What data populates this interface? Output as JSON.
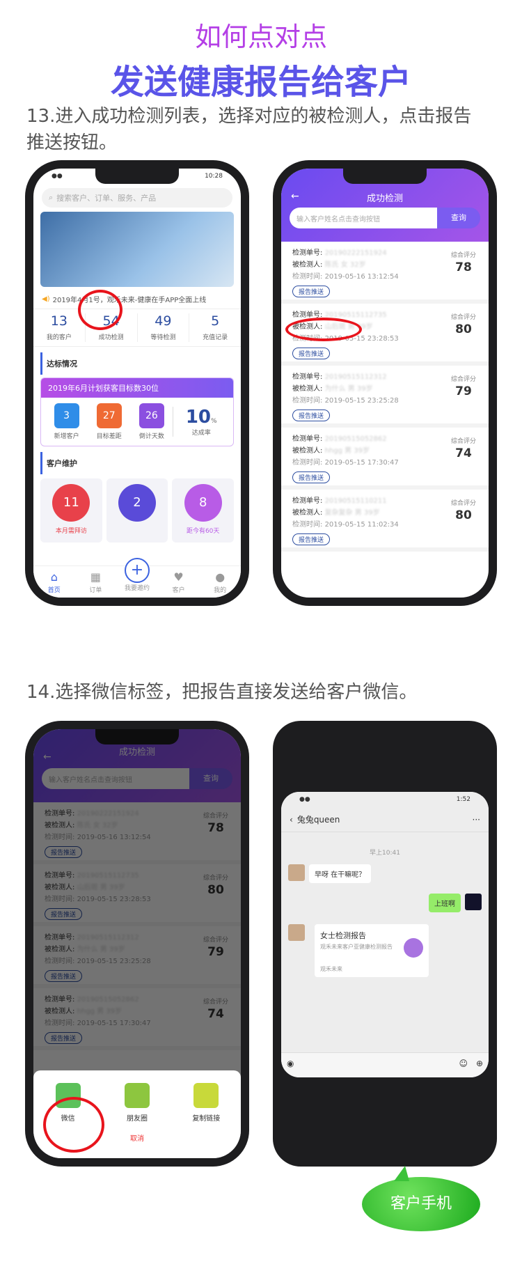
{
  "header": {
    "line1": "如何点对点",
    "line2": "发送健康报告给客户"
  },
  "step13": {
    "line1": "13.进入成功检测列表，选择对应的被检测人，点击报告",
    "line2": "推送按钮。"
  },
  "step14": "14.选择微信标签，把报告直接发送给客户微信。",
  "home": {
    "time": "10:28",
    "search_placeholder": "搜索客户、订单、服务、产品",
    "notice": "2019年4月1号，观禾未来-健康在手APP全面上线",
    "stats": [
      {
        "value": "13",
        "label": "我的客户"
      },
      {
        "value": "54",
        "label": "成功检测"
      },
      {
        "value": "49",
        "label": "等待检测"
      },
      {
        "value": "5",
        "label": "充值记录"
      }
    ],
    "goal_section": "达标情况",
    "goal_title": "2019年6月计划获客目标数30位",
    "goal_items": [
      {
        "value": "3",
        "label": "新增客户",
        "color": "#2f8de8"
      },
      {
        "value": "27",
        "label": "目标差距",
        "color": "#ef6a34"
      },
      {
        "value": "26",
        "label": "倒计天数",
        "color": "#8b4fe0"
      }
    ],
    "goal_rate": "10",
    "goal_rate_unit": "%",
    "goal_rate_label": "达成率",
    "care_section": "客户维护",
    "care": [
      {
        "value": "11",
        "label": "本月需拜访",
        "color": "#e8414a"
      },
      {
        "value": "2",
        "label": "",
        "color": "#5a4bd8"
      },
      {
        "value": "8",
        "label": "距今有60天",
        "color": "#b85ce6"
      }
    ],
    "tabs": [
      "首页",
      "订单",
      "我要邀约",
      "客户",
      "我的"
    ],
    "plus": "+"
  },
  "list": {
    "title": "成功检测",
    "back": "←",
    "search_placeholder": "输入客户姓名点击查询按钮",
    "search_button": "查询",
    "id_label": "检测单号:",
    "person_label": "被检测人:",
    "time_label": "检测时间:",
    "score_label": "综合评分",
    "push_label": "报告推送",
    "records": [
      {
        "id": "20190222151924",
        "person": "陈氏 女 32岁",
        "time": "2019-05-16 13:12:54",
        "score": "78"
      },
      {
        "id": "20190515112735",
        "person": "山后斑 男 39岁",
        "time": "2019-05-15 23:28:53",
        "score": "80"
      },
      {
        "id": "20190515112312",
        "person": "为什么 男 39岁",
        "time": "2019-05-15 23:25:28",
        "score": "79"
      },
      {
        "id": "20190515052862",
        "person": "hhgg 男 39岁",
        "time": "2019-05-15 17:30:47",
        "score": "74"
      },
      {
        "id": "20190515110211",
        "person": "复杂复杂 男 39岁",
        "time": "2019-05-15 11:02:34",
        "score": "80"
      }
    ]
  },
  "share": {
    "options": [
      {
        "label": "微信",
        "color": "#5cc15a"
      },
      {
        "label": "朋友圈",
        "color": "#8dc63f"
      },
      {
        "label": "复制链接",
        "color": "#c8d93a"
      }
    ],
    "cancel": "取消"
  },
  "chat": {
    "time": "1:52",
    "name": "兔兔queen",
    "more": "···",
    "timestamp": "早上10:41",
    "msg_in": "早呀 在干嘛呢？",
    "msg_out": "上班啊",
    "card_title": "女士检测报告",
    "card_desc": "观禾未来客户亚健康检测报告",
    "card_source": "观禾未来"
  },
  "callout": "客户手机"
}
